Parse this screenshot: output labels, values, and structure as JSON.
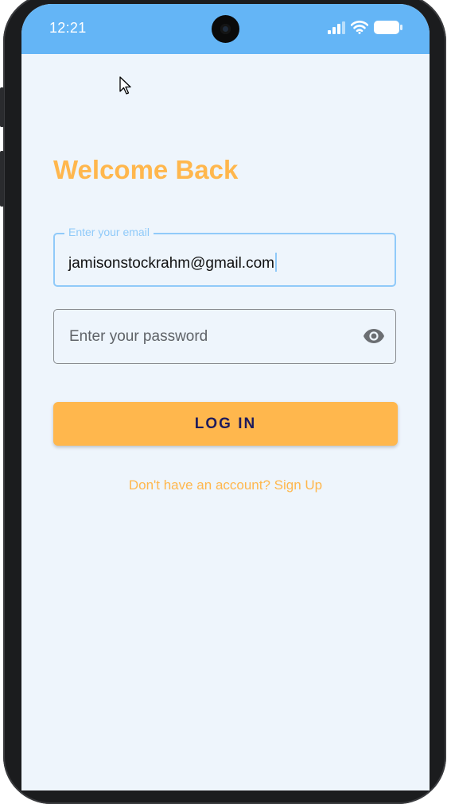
{
  "status_bar": {
    "time": "12:21",
    "icons": [
      "signal-icon",
      "wifi-icon",
      "battery-icon"
    ],
    "background_color": "#64b5f6"
  },
  "login": {
    "title": "Welcome Back",
    "email": {
      "label": "Enter your email",
      "value": "jamisonstockrahm@gmail.com"
    },
    "password": {
      "placeholder": "Enter your password",
      "toggle_icon": "eye-icon"
    },
    "login_button": "LOG IN",
    "signup_link": "Don't have an account? Sign Up"
  },
  "colors": {
    "accent": "#ffb74d",
    "focus": "#90caf9",
    "screen_background": "#eef5fc",
    "button_text": "#1e1b5c"
  }
}
